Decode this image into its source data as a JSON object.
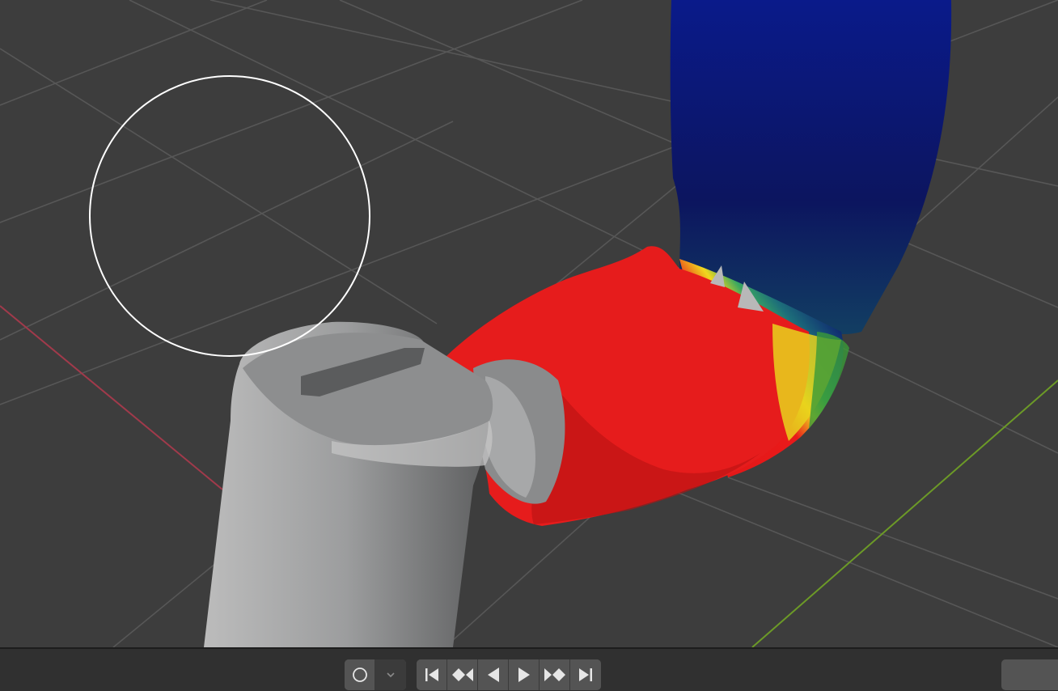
{
  "viewport": {
    "background": "#3d3d3d",
    "grid_color": "#555555",
    "x_axis_color": "#a13a4b",
    "y_axis_color": "#6c9a27",
    "objects": [
      {
        "name": "gray-cylinder-mesh",
        "color": "#9a9b9c"
      },
      {
        "name": "weight-painted-tube-mesh",
        "colors": [
          "#e31818",
          "#f0d21e",
          "#2a9a86",
          "#0e1a6e"
        ]
      }
    ],
    "brush_cursor_icon": "circle-brush-cursor"
  },
  "timeline": {
    "playback_icons": [
      "record-icon",
      "dropdown-chevron-icon"
    ],
    "transport_icons": [
      "jump-to-start-icon",
      "previous-keyframe-icon",
      "play-reverse-icon",
      "play-icon",
      "next-keyframe-icon",
      "jump-to-end-icon"
    ]
  }
}
